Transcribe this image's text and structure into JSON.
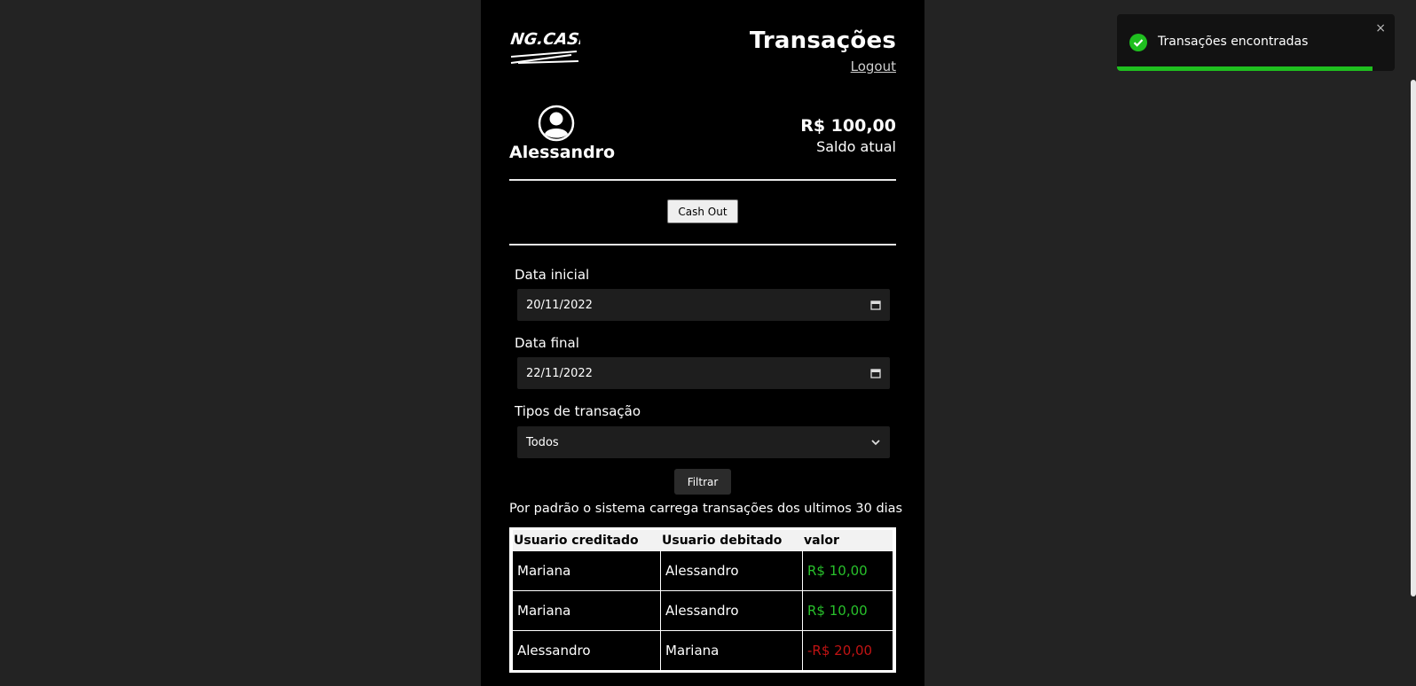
{
  "header": {
    "title": "Transações",
    "logout_label": "Logout"
  },
  "user": {
    "name": "Alessandro",
    "balance": "R$ 100,00",
    "balance_label": "Saldo atual"
  },
  "actions": {
    "cashout_label": "Cash Out",
    "filter_label": "Filtrar"
  },
  "filters": {
    "start_label": "Data inicial",
    "start_value": "20/11/2022",
    "end_label": "Data final",
    "end_value": "22/11/2022",
    "type_label": "Tipos de transação",
    "type_value": "Todos"
  },
  "note": "Por padrão o sistema carrega transações dos ultimos 30 dias",
  "table": {
    "headers": [
      "Usuario creditado",
      "Usuario debitado",
      "valor"
    ],
    "rows": [
      {
        "credited": "Mariana",
        "debited": "Alessandro",
        "value": "R$ 10,00",
        "status": "positive"
      },
      {
        "credited": "Mariana",
        "debited": "Alessandro",
        "value": "R$ 10,00",
        "status": "positive"
      },
      {
        "credited": "Alessandro",
        "debited": "Mariana",
        "value": "-R$ 20,00",
        "status": "negative"
      }
    ]
  },
  "toast": {
    "message": "Transações encontradas",
    "close": "×",
    "progress": 0.92,
    "icon": "check-circle-icon"
  },
  "colors": {
    "positive": "#28c12b",
    "negative": "#c01313",
    "page_bg": "#232323",
    "panel_bg": "#000000",
    "toast_accent": "#1fbf1f"
  }
}
